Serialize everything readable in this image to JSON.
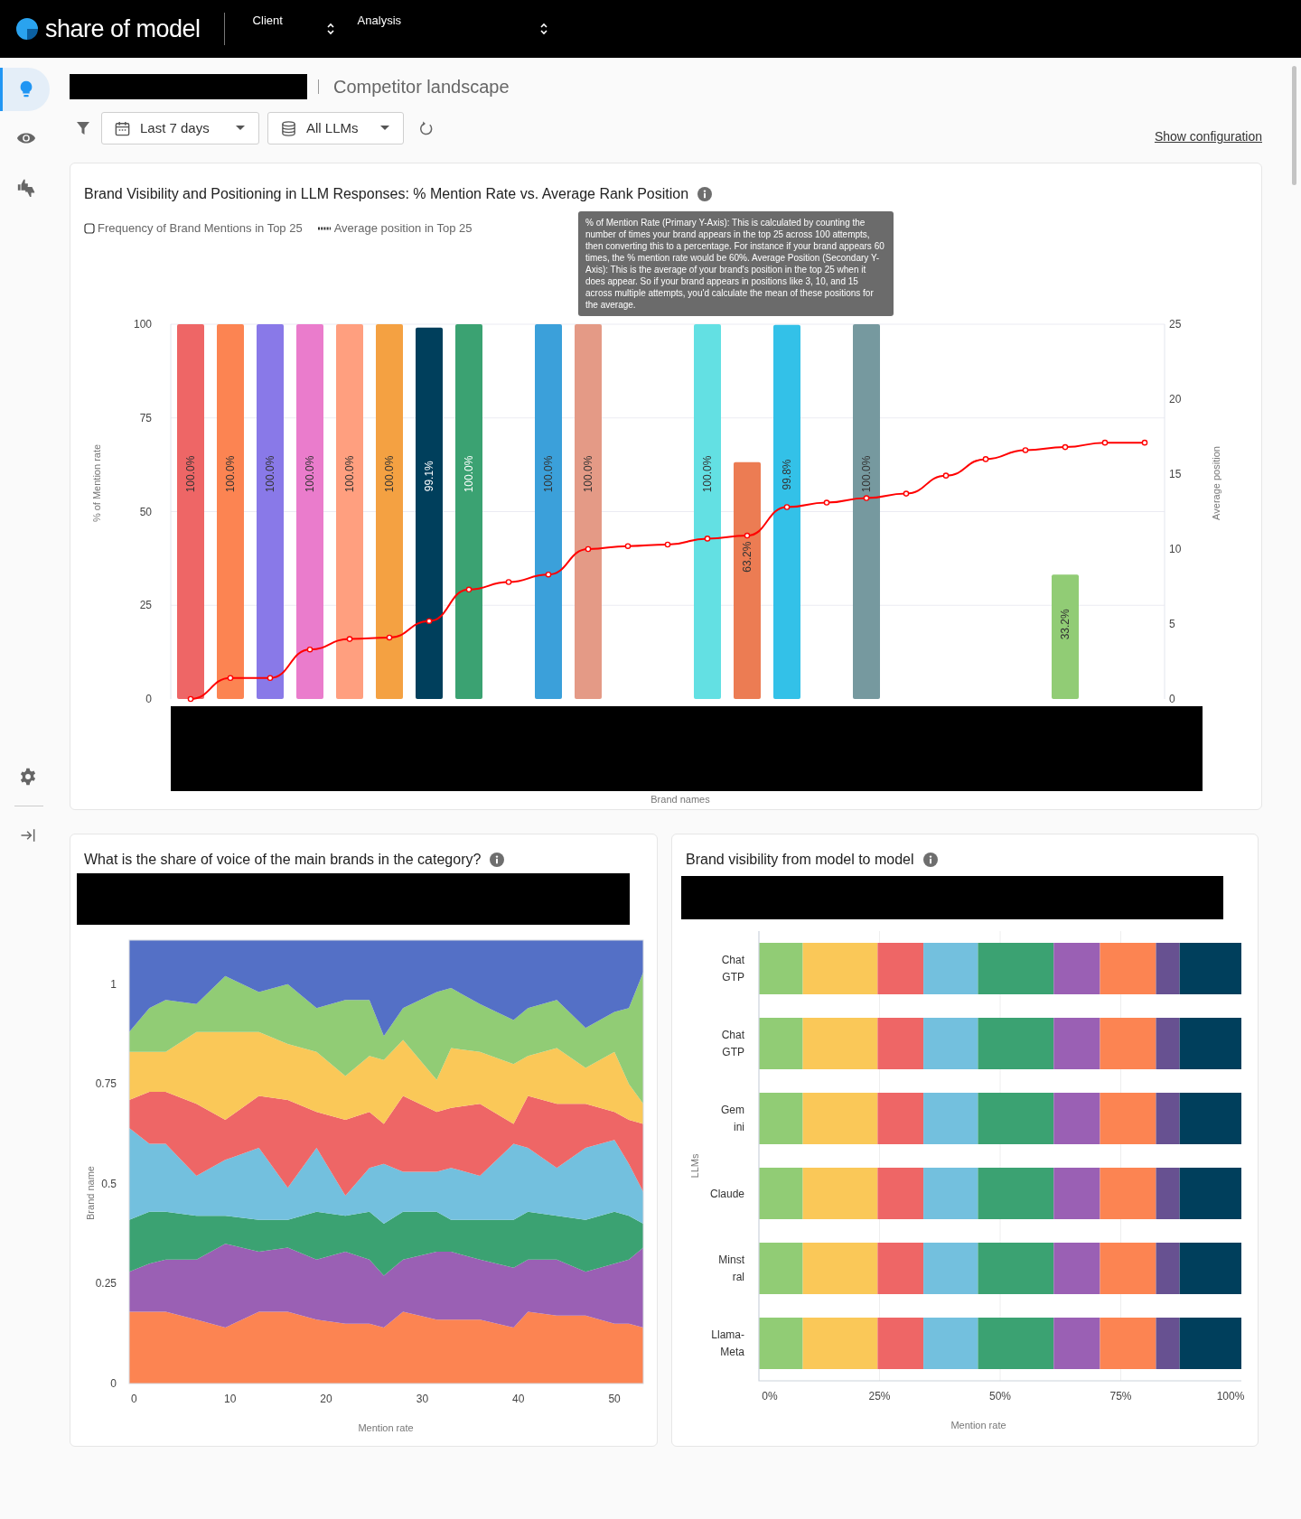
{
  "header": {
    "logo_text": "share of model",
    "client_select": {
      "label": "Client"
    },
    "analysis_select": {
      "label": "Analysis"
    }
  },
  "sidebar": {
    "items": [
      {
        "kind": "bulb",
        "selected": true
      },
      {
        "kind": "eye",
        "selected": false
      },
      {
        "kind": "thumbs",
        "selected": false
      }
    ],
    "bottom_items": [
      {
        "kind": "gear"
      },
      {
        "kind": "collapse"
      }
    ]
  },
  "page": {
    "title": "Competitor landscape",
    "filters": [
      {
        "kind": "date",
        "label": "Last 7 days"
      },
      {
        "kind": "llm",
        "label": "All LLMs"
      }
    ],
    "show_configuration": "Show configuration"
  },
  "cards": [
    {
      "title": "Brand Visibility and Positioning in LLM Responses: % Mention Rate vs. Average Rank Position",
      "tooltip": "% of Mention Rate (Primary Y-Axis): This is calculated by counting the number of times your brand appears in the top 25 across 100 attempts, then converting this to a percentage. For instance if your brand appears 60 times, the % mention rate would be 60%. Average Position (Secondary Y-Axis): This is the average of your brand's position in the top 25 when it does appear. So if your brand appears in positions like 3, 10, and 15 across multiple attempts, you'd calculate the mean of these positions for the average.",
      "chart_data": {
        "type": "bar",
        "grid": true,
        "xlabel": "Brand names",
        "ylabel": "% of Mention rate",
        "y2label": "Average position",
        "ylim": [
          0,
          100
        ],
        "yticks": [
          0,
          25,
          50,
          75,
          100
        ],
        "y2lim": [
          0,
          25
        ],
        "y2ticks": [
          0,
          5,
          10,
          15,
          20,
          25
        ],
        "series": [
          {
            "name": "Frequency of Brand Mentions in Top 25",
            "type": "bar",
            "colors": [
              "#ee6666",
              "#fc8452",
              "#8979e8",
              "#ea7ccc",
              "#ff9f7f",
              "#f4a142",
              "#003f5c",
              "#3ba272",
              null,
              "#3ba0da",
              "#e49a86",
              null,
              null,
              "#63e0e3",
              "#ec7c53",
              "#33c1e8",
              null,
              "#76999f",
              null,
              null,
              null,
              null,
              "#91cc75",
              null,
              null
            ],
            "values": [
              100,
              100,
              100,
              100,
              100,
              100,
              99.1,
              100,
              null,
              100,
              100,
              null,
              null,
              100,
              63.2,
              99.8,
              null,
              100,
              null,
              null,
              null,
              null,
              33.2,
              null,
              null
            ],
            "value_labels": [
              "100.0%",
              "100.0%",
              "100.0%",
              "100.0%",
              "100.0%",
              "100.0%",
              "99.1%",
              "100.0%",
              null,
              "100.0%",
              "100.0%",
              null,
              null,
              "100.0%",
              "63.2%",
              "99.8%",
              null,
              "100.0%",
              null,
              null,
              null,
              null,
              "33.2%",
              null,
              null
            ]
          },
          {
            "name": "Average position in Top 25",
            "type": "line",
            "axis": "y2",
            "marker": true,
            "color": "#ff0000",
            "values": [
              0,
              1.4,
              1.4,
              3.3,
              4.0,
              4.1,
              5.2,
              7.3,
              7.8,
              8.3,
              10.0,
              10.2,
              10.3,
              10.7,
              10.9,
              12.8,
              13.1,
              13.4,
              13.7,
              14.9,
              16.0,
              16.6,
              16.8,
              17.1,
              17.1
            ]
          }
        ]
      }
    },
    {
      "title": "What is the share of voice of the main brands in the category?",
      "chart_data": {
        "type": "area",
        "stacked": true,
        "xlabel": "Mention rate",
        "ylabel": "Brand name",
        "xlim": [
          -0.5,
          53
        ],
        "ylim": [
          0,
          1.11
        ],
        "xticks": [
          0,
          10,
          20,
          30,
          40,
          50
        ],
        "yticks": [
          0,
          0.25,
          0.5,
          0.75,
          1
        ],
        "x": [
          -0.5,
          1.6,
          3.3,
          6.5,
          9.5,
          13,
          16,
          19,
          22,
          24.5,
          26,
          28,
          31.5,
          33,
          36,
          39.5,
          41,
          44,
          47,
          50,
          51.5,
          53
        ],
        "series": [
          {
            "color": "#fc8452",
            "values": [
              0.18,
              0.18,
              0.18,
              0.16,
              0.14,
              0.18,
              0.18,
              0.16,
              0.15,
              0.15,
              0.14,
              0.18,
              0.16,
              0.16,
              0.16,
              0.14,
              0.18,
              0.17,
              0.17,
              0.15,
              0.15,
              0.14
            ]
          },
          {
            "color": "#9a60b4",
            "values": [
              0.1,
              0.12,
              0.13,
              0.15,
              0.21,
              0.15,
              0.16,
              0.15,
              0.18,
              0.16,
              0.13,
              0.13,
              0.17,
              0.17,
              0.15,
              0.15,
              0.13,
              0.14,
              0.11,
              0.15,
              0.16,
              0.2
            ]
          },
          {
            "color": "#3ba272",
            "values": [
              0.13,
              0.13,
              0.12,
              0.11,
              0.07,
              0.08,
              0.07,
              0.12,
              0.09,
              0.12,
              0.13,
              0.12,
              0.1,
              0.08,
              0.1,
              0.12,
              0.12,
              0.11,
              0.13,
              0.13,
              0.11,
              0.06
            ]
          },
          {
            "color": "#73c0de",
            "values": [
              0.23,
              0.17,
              0.17,
              0.1,
              0.14,
              0.18,
              0.08,
              0.16,
              0.05,
              0.11,
              0.15,
              0.1,
              0.1,
              0.13,
              0.11,
              0.19,
              0.16,
              0.12,
              0.18,
              0.18,
              0.13,
              0.08
            ]
          },
          {
            "color": "#ee6666",
            "values": [
              0.07,
              0.13,
              0.13,
              0.18,
              0.1,
              0.13,
              0.22,
              0.09,
              0.19,
              0.14,
              0.1,
              0.19,
              0.15,
              0.15,
              0.18,
              0.05,
              0.13,
              0.16,
              0.11,
              0.07,
              0.11,
              0.17
            ]
          },
          {
            "color": "#fac858",
            "values": [
              0.12,
              0.1,
              0.1,
              0.18,
              0.22,
              0.16,
              0.14,
              0.15,
              0.11,
              0.14,
              0.16,
              0.14,
              0.08,
              0.15,
              0.13,
              0.15,
              0.1,
              0.14,
              0.09,
              0.15,
              0.09,
              0.05
            ]
          },
          {
            "color": "#91cc75",
            "values": [
              0.05,
              0.11,
              0.13,
              0.07,
              0.14,
              0.1,
              0.15,
              0.11,
              0.19,
              0.14,
              0.06,
              0.08,
              0.22,
              0.15,
              0.12,
              0.11,
              0.12,
              0.12,
              0.1,
              0.1,
              0.19,
              0.33
            ]
          },
          {
            "color": "#5470c6",
            "values": [
              0.23,
              0.17,
              0.15,
              0.16,
              0.09,
              0.13,
              0.11,
              0.17,
              0.15,
              0.15,
              0.24,
              0.17,
              0.13,
              0.12,
              0.16,
              0.2,
              0.17,
              0.15,
              0.22,
              0.18,
              0.17,
              0.08
            ]
          }
        ]
      }
    },
    {
      "title": "Brand visibility from model to model",
      "chart_data": {
        "type": "bar",
        "orientation": "horizontal",
        "grid": true,
        "stacked": true,
        "xlabel": "Mention rate",
        "ylabel": "LLMs",
        "xlim": [
          0,
          100
        ],
        "xticks": [
          {
            "value": 0,
            "label": "0%"
          },
          {
            "value": 25,
            "label": "25%"
          },
          {
            "value": 50,
            "label": "50%"
          },
          {
            "value": 75,
            "label": "75%"
          },
          {
            "value": 100,
            "label": "100%"
          }
        ],
        "categories": [
          "Chat\nGTP",
          "Chat\nGTP",
          "Gem\nini",
          "Claude",
          "Minst\nral",
          "Llama-\nMeta"
        ],
        "series": [
          {
            "color": "#91cc75",
            "values": [
              9.1,
              9.1,
              9.1,
              9.1,
              9.1,
              9.1
            ]
          },
          {
            "color": "#fac858",
            "values": [
              15.5,
              15.5,
              15.5,
              15.5,
              15.5,
              15.5
            ]
          },
          {
            "color": "#ee6666",
            "values": [
              9.5,
              9.5,
              9.5,
              9.5,
              9.5,
              9.5
            ]
          },
          {
            "color": "#73c0de",
            "values": [
              11.3,
              11.3,
              11.3,
              11.3,
              11.3,
              11.3
            ]
          },
          {
            "color": "#3ba272",
            "values": [
              15.7,
              15.7,
              15.7,
              15.7,
              15.7,
              15.7
            ]
          },
          {
            "color": "#9a60b4",
            "values": [
              9.6,
              9.6,
              9.6,
              9.6,
              9.6,
              9.6
            ]
          },
          {
            "color": "#fc8452",
            "values": [
              11.6,
              11.6,
              11.6,
              11.6,
              11.6,
              11.6
            ]
          },
          {
            "color": "#675191",
            "values": [
              4.9,
              4.9,
              4.9,
              4.9,
              4.9,
              4.9
            ]
          },
          {
            "color": "#003f5c",
            "values": [
              12.8,
              12.8,
              12.8,
              12.8,
              12.8,
              12.8
            ]
          }
        ]
      }
    }
  ]
}
